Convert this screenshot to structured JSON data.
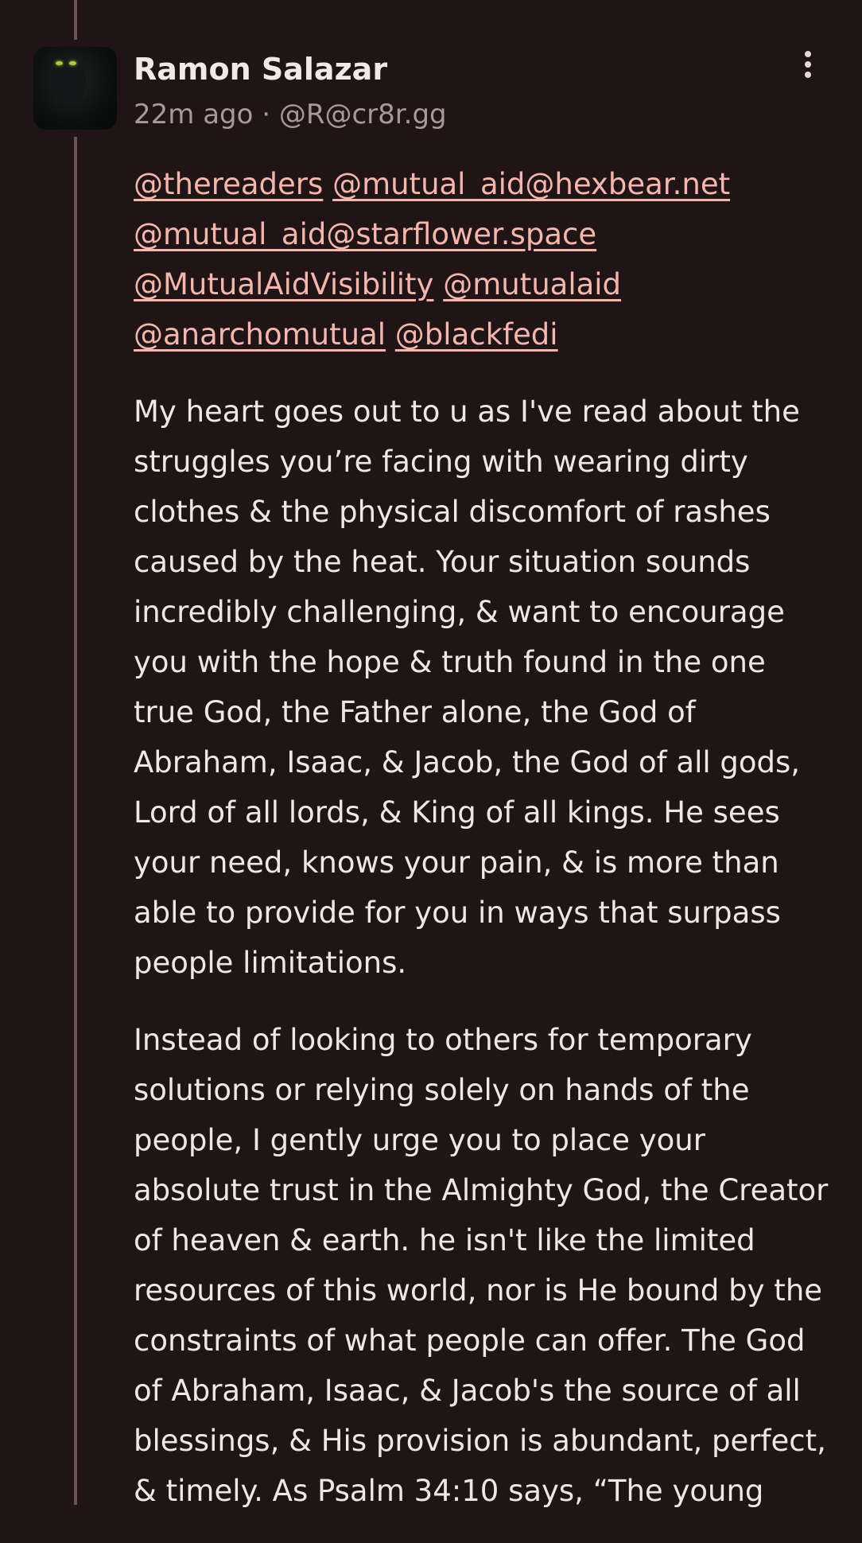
{
  "post": {
    "author": "Ramon Salazar",
    "time_ago": "22m ago",
    "separator": "·",
    "handle": "@R@cr8r.gg",
    "menu_icon": "more-vertical-icon",
    "avatar_icon": "avatar-image",
    "mentions": [
      "@thereaders",
      "@mutual_aid@hexbear.net",
      "@mutual_aid@starflower.space",
      "@MutualAidVisibility",
      "@mutualaid",
      "@anarchomutual",
      "@blackfedi"
    ],
    "paragraphs": [
      "My heart goes out to u as I've read about the struggles you’re facing with wearing dirty clothes & the physical discomfort of rashes caused by the heat. Your situation sounds incredibly challenging, & want to encourage you with the hope & truth found in the one true God, the Father alone, the God of Abraham, Isaac, & Jacob, the God of all gods, Lord of all lords, & King of all kings. He sees your need, knows your pain, & is more than able to provide for you in ways that surpass people limitations.",
      "Instead of looking to others for temporary solutions or relying solely on hands of the people, I gently urge you to place your absolute trust in the Almighty God, the Creator of heaven & earth. he isn't like the limited resources of this world, nor is He bound by the constraints of what people can offer. The God of Abraham, Isaac, & Jacob's the source of all blessings, & His provision is abundant, perfect, & timely. As Psalm 34:10 says, “The young"
    ]
  }
}
